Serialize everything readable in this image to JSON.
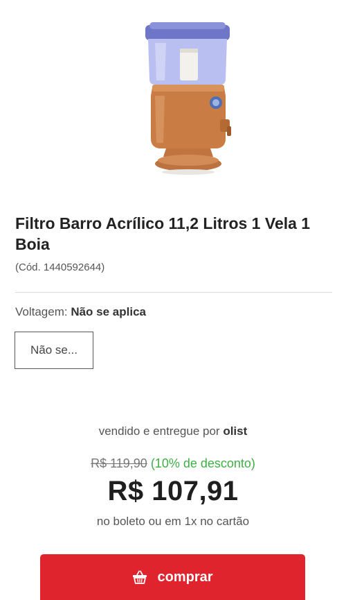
{
  "product": {
    "title": "Filtro Barro Acrílico 11,2 Litros 1 Vela 1 Boia",
    "code": "(Cód. 1440592644)",
    "image_icon": "water-filter-image"
  },
  "variation": {
    "label": "Voltagem: ",
    "selected_value": "Não se aplica",
    "option_label": "Não se..."
  },
  "seller": {
    "prefix": "vendido e entregue por ",
    "name": "olist"
  },
  "price": {
    "old": "R$ 119,90",
    "discount": " (10% de desconto)",
    "current": "R$ 107,91",
    "payment_note": "no boleto ou em 1x no cartão"
  },
  "buy": {
    "label": "comprar",
    "icon": "basket-icon"
  },
  "colors": {
    "accent": "#e0242d",
    "discount": "#3cb043",
    "text": "#1f1f1f"
  }
}
